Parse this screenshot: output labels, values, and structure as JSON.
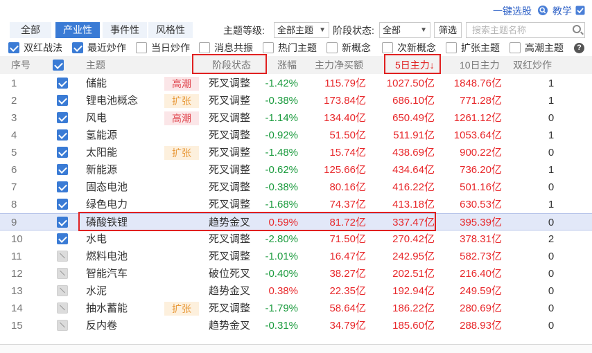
{
  "top": {
    "one_click_label": "一键选股",
    "tutorial_label": "教学"
  },
  "toolbar": {
    "tabs": [
      {
        "label": "全部",
        "active": false
      },
      {
        "label": "产业性",
        "active": true
      },
      {
        "label": "事件性",
        "active": false
      },
      {
        "label": "风格性",
        "active": false
      }
    ],
    "level_label": "主题等级:",
    "level_value": "全部主题",
    "stage_label": "阶段状态:",
    "stage_value": "全部",
    "filter_button": "筛选",
    "search_placeholder": "搜索主题名称"
  },
  "filters": [
    {
      "label": "双红战法",
      "checked": true
    },
    {
      "label": "最近炒作",
      "checked": true
    },
    {
      "label": "当日炒作",
      "checked": false
    },
    {
      "label": "消息共振",
      "checked": false
    },
    {
      "label": "热门主题",
      "checked": false
    },
    {
      "label": "新概念",
      "checked": false
    },
    {
      "label": "次新概念",
      "checked": false
    },
    {
      "label": "扩张主题",
      "checked": false
    },
    {
      "label": "高潮主题",
      "checked": false
    }
  ],
  "table": {
    "headers": {
      "seq": "序号",
      "topic": "主题",
      "stage": "阶段状态",
      "change": "涨幅",
      "net_buy": "主力净买额",
      "d5": "5日主力↓",
      "d10": "10日主力",
      "double_red": "双红炒作"
    },
    "rows": [
      {
        "seq": "1",
        "checked": true,
        "name": "储能",
        "tag": "高潮",
        "tag_type": "hot",
        "stage": "死叉调整",
        "change": "-1.42%",
        "dir": "down",
        "net": "115.79亿",
        "d5": "1027.50亿",
        "d10": "1848.76亿",
        "dbl": "1"
      },
      {
        "seq": "2",
        "checked": true,
        "name": "锂电池概念",
        "tag": "扩张",
        "tag_type": "exp",
        "stage": "死叉调整",
        "change": "-0.38%",
        "dir": "down",
        "net": "173.84亿",
        "d5": "686.10亿",
        "d10": "771.28亿",
        "dbl": "1"
      },
      {
        "seq": "3",
        "checked": true,
        "name": "风电",
        "tag": "高潮",
        "tag_type": "hot",
        "stage": "死叉调整",
        "change": "-1.14%",
        "dir": "down",
        "net": "134.40亿",
        "d5": "650.49亿",
        "d10": "1261.12亿",
        "dbl": "0"
      },
      {
        "seq": "4",
        "checked": true,
        "name": "氢能源",
        "tag": "",
        "tag_type": "",
        "stage": "死叉调整",
        "change": "-0.92%",
        "dir": "down",
        "net": "51.50亿",
        "d5": "511.91亿",
        "d10": "1053.64亿",
        "dbl": "1"
      },
      {
        "seq": "5",
        "checked": true,
        "name": "太阳能",
        "tag": "扩张",
        "tag_type": "exp",
        "stage": "死叉调整",
        "change": "-1.48%",
        "dir": "down",
        "net": "15.74亿",
        "d5": "438.69亿",
        "d10": "900.22亿",
        "dbl": "0"
      },
      {
        "seq": "6",
        "checked": true,
        "name": "新能源",
        "tag": "",
        "tag_type": "",
        "stage": "死叉调整",
        "change": "-0.62%",
        "dir": "down",
        "net": "125.66亿",
        "d5": "434.64亿",
        "d10": "736.20亿",
        "dbl": "1"
      },
      {
        "seq": "7",
        "checked": true,
        "name": "固态电池",
        "tag": "",
        "tag_type": "",
        "stage": "死叉调整",
        "change": "-0.38%",
        "dir": "down",
        "net": "80.16亿",
        "d5": "416.22亿",
        "d10": "501.16亿",
        "dbl": "0"
      },
      {
        "seq": "8",
        "checked": true,
        "name": "绿色电力",
        "tag": "",
        "tag_type": "",
        "stage": "死叉调整",
        "change": "-1.68%",
        "dir": "down",
        "net": "74.37亿",
        "d5": "413.18亿",
        "d10": "630.53亿",
        "dbl": "1"
      },
      {
        "seq": "9",
        "checked": true,
        "name": "磷酸铁锂",
        "tag": "",
        "tag_type": "",
        "stage": "趋势金叉",
        "change": "0.59%",
        "dir": "up",
        "net": "81.72亿",
        "d5": "337.47亿",
        "d10": "395.39亿",
        "dbl": "0",
        "selected": true
      },
      {
        "seq": "10",
        "checked": true,
        "name": "水电",
        "tag": "",
        "tag_type": "",
        "stage": "死叉调整",
        "change": "-2.80%",
        "dir": "down",
        "net": "71.50亿",
        "d5": "270.42亿",
        "d10": "378.31亿",
        "dbl": "2"
      },
      {
        "seq": "11",
        "checked": false,
        "name": "燃料电池",
        "tag": "",
        "tag_type": "",
        "stage": "死叉调整",
        "change": "-1.01%",
        "dir": "down",
        "net": "16.47亿",
        "d5": "242.95亿",
        "d10": "582.73亿",
        "dbl": "0"
      },
      {
        "seq": "12",
        "checked": false,
        "name": "智能汽车",
        "tag": "",
        "tag_type": "",
        "stage": "破位死叉",
        "change": "-0.40%",
        "dir": "down",
        "net": "38.27亿",
        "d5": "202.51亿",
        "d10": "216.40亿",
        "dbl": "0"
      },
      {
        "seq": "13",
        "checked": false,
        "name": "水泥",
        "tag": "",
        "tag_type": "",
        "stage": "趋势金叉",
        "change": "0.38%",
        "dir": "up",
        "net": "22.35亿",
        "d5": "192.94亿",
        "d10": "249.59亿",
        "dbl": "0"
      },
      {
        "seq": "14",
        "checked": false,
        "name": "抽水蓄能",
        "tag": "扩张",
        "tag_type": "exp",
        "stage": "死叉调整",
        "change": "-1.79%",
        "dir": "down",
        "net": "58.64亿",
        "d5": "186.22亿",
        "d10": "280.69亿",
        "dbl": "0"
      },
      {
        "seq": "15",
        "checked": false,
        "name": "反内卷",
        "tag": "",
        "tag_type": "",
        "stage": "趋势金叉",
        "change": "-0.31%",
        "dir": "down",
        "net": "34.79亿",
        "d5": "185.60亿",
        "d10": "288.93亿",
        "dbl": "0"
      }
    ]
  }
}
